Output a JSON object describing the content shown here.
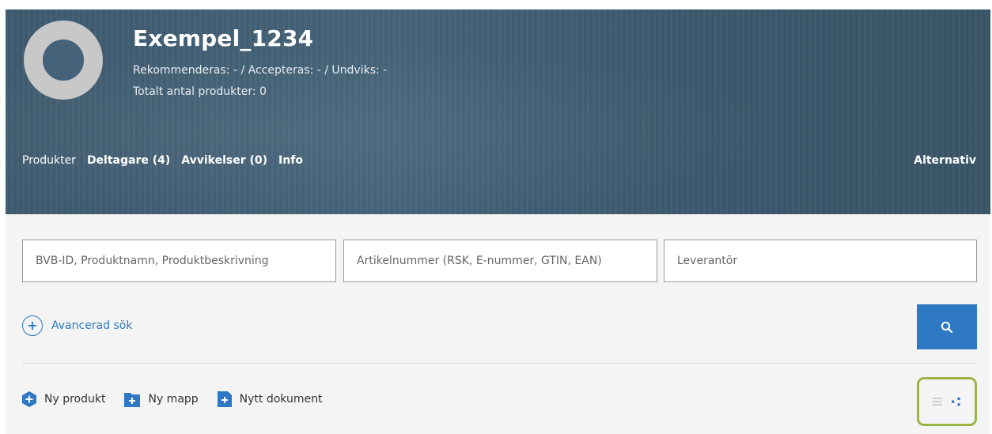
{
  "header": {
    "title": "Exempel_1234",
    "rating_line": "Rekommenderas: - / Accepteras: - / Undviks: -",
    "total_line": "Totalt antal produkter: 0"
  },
  "tabs": [
    {
      "label": "Produkter",
      "active": true
    },
    {
      "label": "Deltagare (4)"
    },
    {
      "label": "Avvikelser (0)"
    },
    {
      "label": "Info"
    }
  ],
  "options_label": "Alternativ",
  "search": {
    "name_placeholder": "BVB-ID, Produktnamn, Produktbeskrivning",
    "article_placeholder": "Artikelnummer (RSK, E-nummer, GTIN, EAN)",
    "supplier_placeholder": "Leverantör",
    "advanced_label": "Avancerad sök"
  },
  "actions": {
    "new_product": "Ny produkt",
    "new_folder": "Ny mapp",
    "new_document": "Nytt dokument"
  },
  "colors": {
    "accent": "#2f78c4",
    "highlight_border": "#9ab446",
    "header_bg": "#42607a"
  },
  "icons": {
    "search": "search-icon",
    "list_view": "list-view-icon",
    "tree_view": "tree-view-icon"
  }
}
